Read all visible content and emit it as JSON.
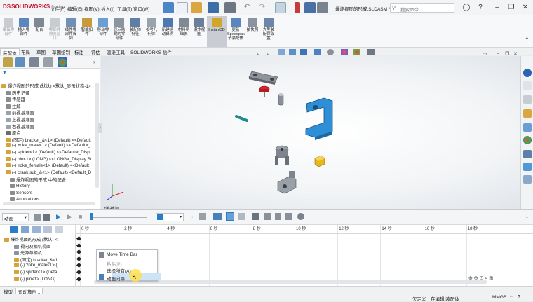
{
  "app": {
    "brand_mark": "DS",
    "brand": "SOLIDWORKS",
    "brand_sub": "Design"
  },
  "menu": [
    "文件(F)",
    "编辑(E)",
    "视图(V)",
    "插入(I)",
    "工具(T)",
    "窗口(W)"
  ],
  "document_title": "爆炸视图的形成.SLDASM *",
  "search": {
    "placeholder": "搜索命令"
  },
  "ribbon": [
    {
      "label": "编辑零\n部件",
      "icon": "edit-component-icon",
      "disabled": true
    },
    {
      "label": "插入零\n部件",
      "icon": "insert-component-icon",
      "disabled": false
    },
    {
      "label": "配合",
      "icon": "mate-icon",
      "disabled": false
    },
    {
      "label": "零部件\n预览窗\n口",
      "icon": "component-preview-icon",
      "disabled": true
    },
    {
      "label": "线性零\n部件阵\n列",
      "icon": "linear-pattern-icon",
      "disabled": false
    },
    {
      "label": "智能扣\n件",
      "icon": "smart-fastener-icon",
      "disabled": false
    },
    {
      "label": "移动零\n部件",
      "icon": "move-component-icon",
      "disabled": false
    },
    {
      "label": "显示隐\n藏的零\n部件",
      "icon": "show-hidden-icon",
      "disabled": false
    },
    {
      "label": "装配体\n特征",
      "icon": "assembly-feature-icon",
      "disabled": false
    },
    {
      "label": "参考几\n何体",
      "icon": "reference-geometry-icon",
      "disabled": false
    },
    {
      "label": "新建运\n动算例",
      "icon": "new-motion-study-icon",
      "disabled": false
    },
    {
      "label": "材料明\n细表",
      "icon": "bom-icon",
      "disabled": false
    },
    {
      "label": "爆炸视\n图",
      "icon": "exploded-view-icon",
      "disabled": false
    },
    {
      "label": "Instant3D",
      "icon": "instant3d-icon",
      "disabled": false,
      "active": true
    },
    {
      "label": "更新\nSpeedpak\n子装配体",
      "icon": "speedpak-icon",
      "disabled": false
    },
    {
      "label": "拍快照",
      "icon": "snapshot-icon",
      "disabled": false
    },
    {
      "label": "大型装\n配体设\n置",
      "icon": "large-assembly-icon",
      "disabled": false
    }
  ],
  "command_tabs": [
    "装配体",
    "布局",
    "草图",
    "草图绘制",
    "标注",
    "评估",
    "渲染工具",
    "SOLIDWORKS 插件"
  ],
  "feature_tree": [
    {
      "indent": 0,
      "label": "爆炸视图的形成 (默认) <默认_显示状态-1>",
      "icon": "assembly-icon",
      "color": "#d6a33a"
    },
    {
      "indent": 1,
      "label": "历史记录",
      "icon": "history-icon",
      "color": "#8c8c8c"
    },
    {
      "indent": 1,
      "label": "传感器",
      "icon": "sensors-icon",
      "color": "#8c8c8c"
    },
    {
      "indent": 1,
      "label": "注解",
      "icon": "annotations-icon",
      "color": "#8c8c8c"
    },
    {
      "indent": 1,
      "label": "前视基准面",
      "icon": "plane-icon",
      "color": "#9aa3ad"
    },
    {
      "indent": 1,
      "label": "上视基准面",
      "icon": "plane-icon",
      "color": "#9aa3ad"
    },
    {
      "indent": 1,
      "label": "右视基准面",
      "icon": "plane-icon",
      "color": "#9aa3ad"
    },
    {
      "indent": 1,
      "label": "原点",
      "icon": "origin-icon",
      "color": "#6c6c6c"
    },
    {
      "indent": 1,
      "label": "(固定) bracket_&<1> (Default) <<Default",
      "icon": "part-icon",
      "color": "#d6a33a"
    },
    {
      "indent": 1,
      "label": "(-) Yoke_male<1> (Default) <<Default>_",
      "icon": "part-icon",
      "color": "#d6a33a"
    },
    {
      "indent": 1,
      "label": "(-) spider<1> (Default) <<Default>_Disp",
      "icon": "part-icon",
      "color": "#d6a33a"
    },
    {
      "indent": 1,
      "label": "(-) pin<1> (LONG) <<LONG>_Display St",
      "icon": "part-icon",
      "color": "#d6a33a"
    },
    {
      "indent": 1,
      "label": "(-) Yoke_female<1> (Default) <<Default",
      "icon": "part-icon",
      "color": "#d6a33a"
    },
    {
      "indent": 1,
      "label": "(-) crank sub_&<1> (Default) <Default_D",
      "icon": "subassembly-icon",
      "color": "#d6a33a"
    },
    {
      "indent": 2,
      "label": "爆炸视图的形成 中的配合",
      "icon": "mates-icon",
      "color": "#8c8c8c"
    },
    {
      "indent": 2,
      "label": "History",
      "icon": "history-icon",
      "color": "#8c8c8c"
    },
    {
      "indent": 2,
      "label": "Sensors",
      "icon": "sensors-icon",
      "color": "#8c8c8c"
    },
    {
      "indent": 2,
      "label": "Annotations",
      "icon": "annotations-icon",
      "color": "#8c8c8c"
    }
  ],
  "view_label": "*等轴测",
  "motion": {
    "study_type": "动画",
    "speed_value": "",
    "timeline_ticks": [
      "0 秒",
      "2 秒",
      "4 秒",
      "6 秒",
      "8 秒",
      "10 秒",
      "12 秒",
      "14 秒",
      "16 秒",
      "18 秒"
    ],
    "tree": [
      {
        "indent": 0,
        "label": "爆炸视图的形成 (默认) <"
      },
      {
        "indent": 1,
        "label": "视向及相机视图"
      },
      {
        "indent": 1,
        "label": "光源与相机"
      },
      {
        "indent": 1,
        "label": "(固定) bracket_&<1"
      },
      {
        "indent": 1,
        "label": "(-) Yoke_male<1> ("
      },
      {
        "indent": 1,
        "label": "(-) spider<1> (Defa"
      },
      {
        "indent": 1,
        "label": "(-) pin<1> (LONG)"
      }
    ]
  },
  "context_menu": [
    {
      "label": "Move Time Bar",
      "disabled": false
    },
    {
      "label": "粘贴(P)",
      "disabled": true
    },
    {
      "label": "选择所有(A)",
      "disabled": false
    },
    {
      "label": "动画向导...",
      "disabled": false
    }
  ],
  "bottom_tabs": [
    "模型",
    "运动算例 1"
  ],
  "status": {
    "mode": "欠定义",
    "editing": "在编辑 装配体",
    "units": "MMGS"
  },
  "colors": {
    "accent": "#2a7cc7",
    "part_blue": "#2f8fd6",
    "highlight": "#ffe14d"
  }
}
